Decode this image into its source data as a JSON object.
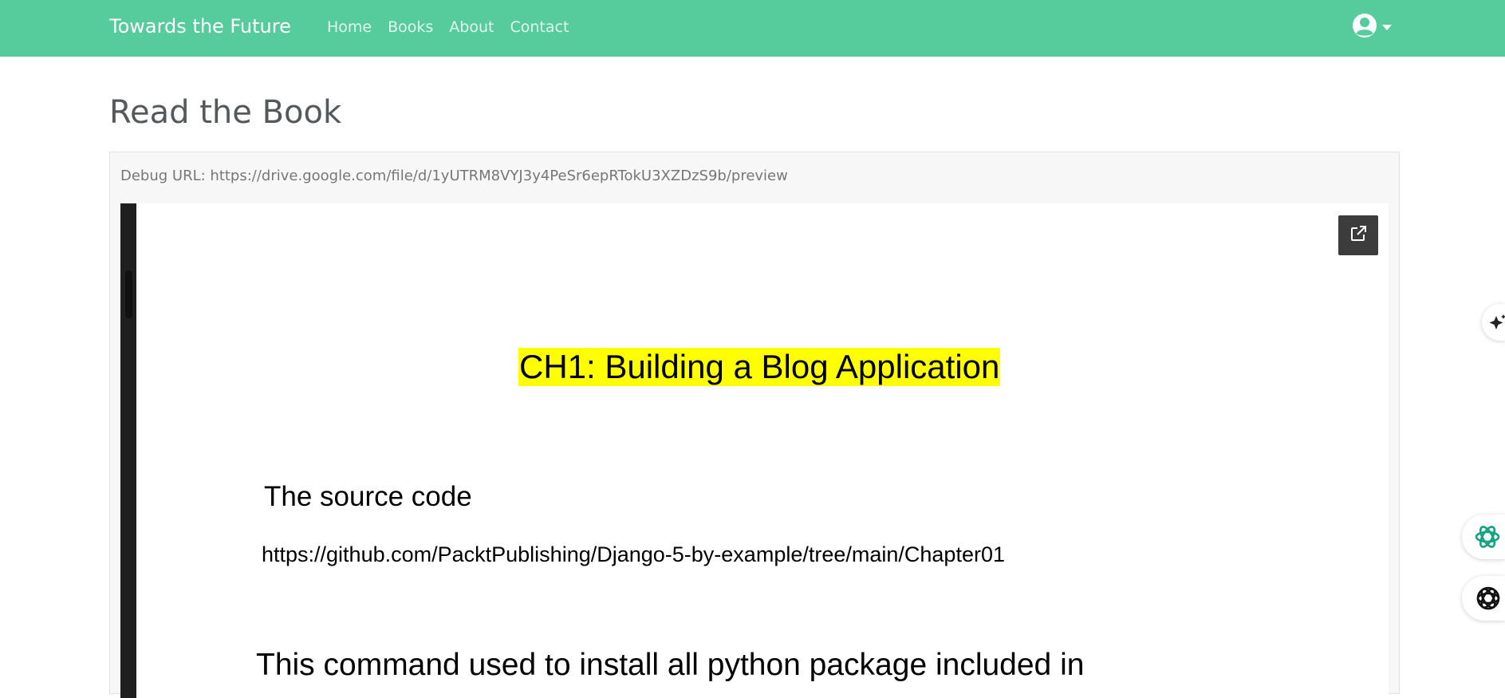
{
  "navbar": {
    "brand": "Towards the Future",
    "links": [
      "Home",
      "Books",
      "About",
      "Contact"
    ],
    "user_icon": "user-circle-icon",
    "caret_icon": "caret-down-icon",
    "bg_color": "#56cc9d"
  },
  "page": {
    "title": "Read the Book"
  },
  "card": {
    "debug_url": "Debug URL: https://drive.google.com/file/d/1yUTRM8VYJ3y4PeSr6epRTokU3XZDzS9b/preview"
  },
  "document": {
    "heading": "CH1: Building a Blog Application",
    "subheading": "The source code",
    "link": "https://github.com/PacktPublishing/Django-5-by-example/tree/main/Chapter01",
    "body": "This command used to install all python package included in",
    "popout_icon": "open-in-new-window-icon",
    "heading_highlight": "#ffff00"
  },
  "floating_buttons": [
    {
      "icon": "sparkle-icon"
    },
    {
      "icon": "chatgpt-icon"
    },
    {
      "icon": "ai-assistant-icon"
    }
  ]
}
